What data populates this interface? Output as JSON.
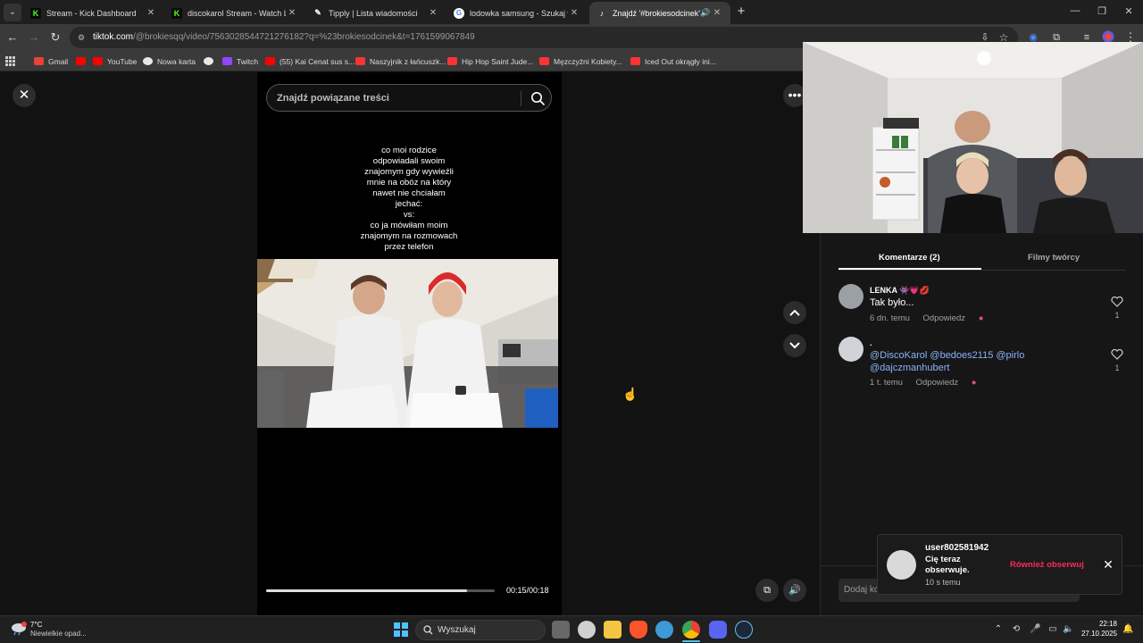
{
  "browser": {
    "tabs": [
      {
        "title": "Stream - Kick Dashboard",
        "icon": "kick-icon",
        "color": "#53fc18"
      },
      {
        "title": "discokarol Stream - Watch Live",
        "icon": "kick-icon",
        "color": "#53fc18"
      },
      {
        "title": "Tipply | Lista wiadomości",
        "icon": "tipply-icon",
        "color": "#ffffff"
      },
      {
        "title": "lodowka samsung - Szukaj w Go",
        "icon": "google-icon",
        "color": "#4285f4"
      },
      {
        "title": "Znajdź '#brokiesodcinek' na",
        "icon": "tiktok-icon",
        "color": "#ffffff"
      }
    ],
    "url_host": "tiktok.com",
    "url_rest": "/@brokiesqq/video/7563028544721276182?q=%23brokiesodcinek&t=1761599067849",
    "bookmarks": [
      {
        "label": "Gmail",
        "color": "#ea4335"
      },
      {
        "label": "",
        "color": "#ff0000"
      },
      {
        "label": "YouTube",
        "color": "#ff0000"
      },
      {
        "label": "Nowa karta",
        "color": "#e8e8e8"
      },
      {
        "label": "",
        "color": "#e8e8e8"
      },
      {
        "label": "Twitch",
        "color": "#9146ff"
      },
      {
        "label": "(55) Kai Cenat sus s...",
        "color": "#ff0000"
      },
      {
        "label": "Naszyjnik z łańcuszk...",
        "color": "#ff3333"
      },
      {
        "label": "Hip Hop Saint Jude...",
        "color": "#ff3333"
      },
      {
        "label": "Męzczyźni Kobiety...",
        "color": "#ff3333"
      },
      {
        "label": "Iced Out okrągły ini...",
        "color": "#ff3333"
      }
    ]
  },
  "video": {
    "search_placeholder": "Znajdź powiązane treści",
    "caption_lines": [
      "co moi rodzice",
      "odpowiadali swoim",
      "znajomym gdy wywieźli",
      "mnie na obóz na który",
      "nawet nie chciałam",
      "jechać:",
      "vs:",
      "co ja mówiłam moim",
      "znajomym na rozmowach",
      "przez telefon"
    ],
    "timecode": "00:15/00:18",
    "progress": 0.88
  },
  "panel": {
    "tab_comments": "Komentarze (2)",
    "tab_creator": "Filmy twórcy",
    "comments": [
      {
        "user": "LENKA",
        "user_emojis": "👾💗💋",
        "text": "Tak było...",
        "time": "6 dn. temu",
        "reply": "Odpowiedz",
        "likes": "1"
      },
      {
        "user": ".",
        "mentions_line1": "@DiscoKarol @bedoes2115 @pirlo",
        "mentions_line2": "@dajczmanhubert",
        "time": "1 t. temu",
        "reply": "Odpowiedz",
        "likes": "1"
      }
    ],
    "comment_placeholder": "Dodaj ko"
  },
  "toast": {
    "user": "user802581942",
    "message": "Cię teraz obserwuje.",
    "time": "10 s temu",
    "follow_back": "Również obserwuj"
  },
  "taskbar": {
    "temperature": "7°C",
    "weather": "Niewielkie opad...",
    "search_label": "Wyszukaj",
    "time": "22:18",
    "date": "27.10.2025",
    "apps": [
      {
        "name": "task-view-icon",
        "color": "#9a9a9a"
      },
      {
        "name": "chatgpt-icon",
        "color": "#d0d0d0"
      },
      {
        "name": "file-explorer-icon",
        "color": "#f4c542"
      },
      {
        "name": "brave-icon",
        "color": "#fb542b"
      },
      {
        "name": "ccleaner-icon",
        "color": "#3c9ad6"
      },
      {
        "name": "chrome-icon",
        "color": "#4285f4"
      },
      {
        "name": "discord-icon",
        "color": "#5865f2"
      },
      {
        "name": "steam-icon",
        "color": "#1b2838"
      }
    ]
  }
}
